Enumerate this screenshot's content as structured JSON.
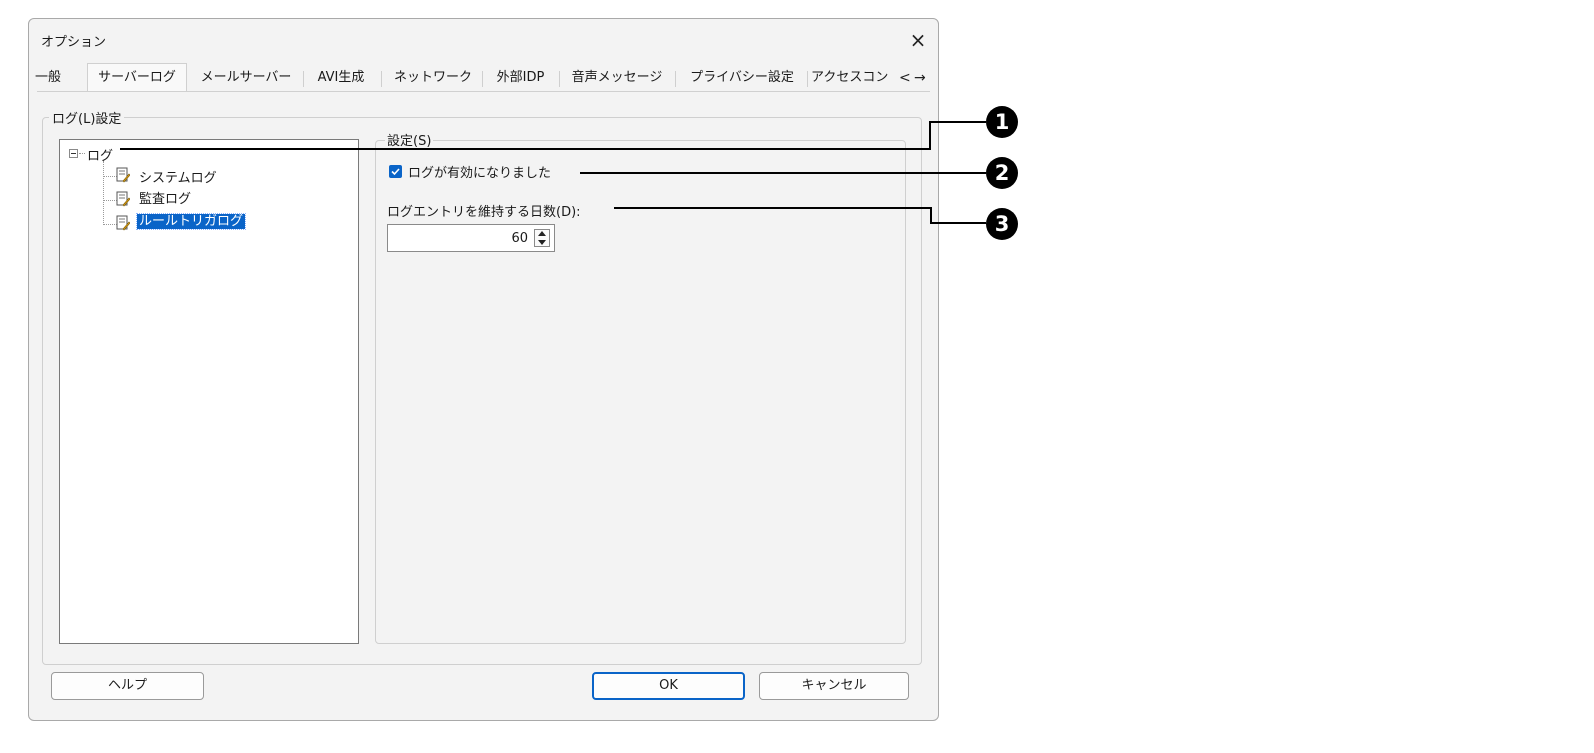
{
  "window": {
    "title": "オプション",
    "close_glyph": "×"
  },
  "tabs": [
    {
      "label": "一般"
    },
    {
      "label": "サーバーログ",
      "active": true
    },
    {
      "label": "メールサーバー"
    },
    {
      "label": "AVI生成"
    },
    {
      "label": "ネットワーク"
    },
    {
      "label": "外部IDP"
    },
    {
      "label": "音声メッセージ"
    },
    {
      "label": "プライバシー設定"
    },
    {
      "label": "アクセスコン"
    }
  ],
  "tab_scroll": {
    "left": "<",
    "right": "→"
  },
  "log_group": {
    "label": "ログ(L)設定"
  },
  "tree": {
    "root": "ログ",
    "items": [
      "システムログ",
      "監査ログ",
      "ルールトリガログ"
    ],
    "selected": "ルールトリガログ"
  },
  "settings": {
    "group_label": "設定(S)",
    "log_enabled_label": "ログが有効になりました",
    "log_enabled_checked": true,
    "days_label": "ログエントリを維持する日数(D):",
    "days_value": "60"
  },
  "buttons": {
    "help": "ヘルプ",
    "ok": "OK",
    "cancel": "キャンセル"
  },
  "callouts": [
    "1",
    "2",
    "3"
  ],
  "colors": {
    "accent": "#0a64c8",
    "dialog_bg": "#f3f3f3",
    "callout": "#000000"
  }
}
